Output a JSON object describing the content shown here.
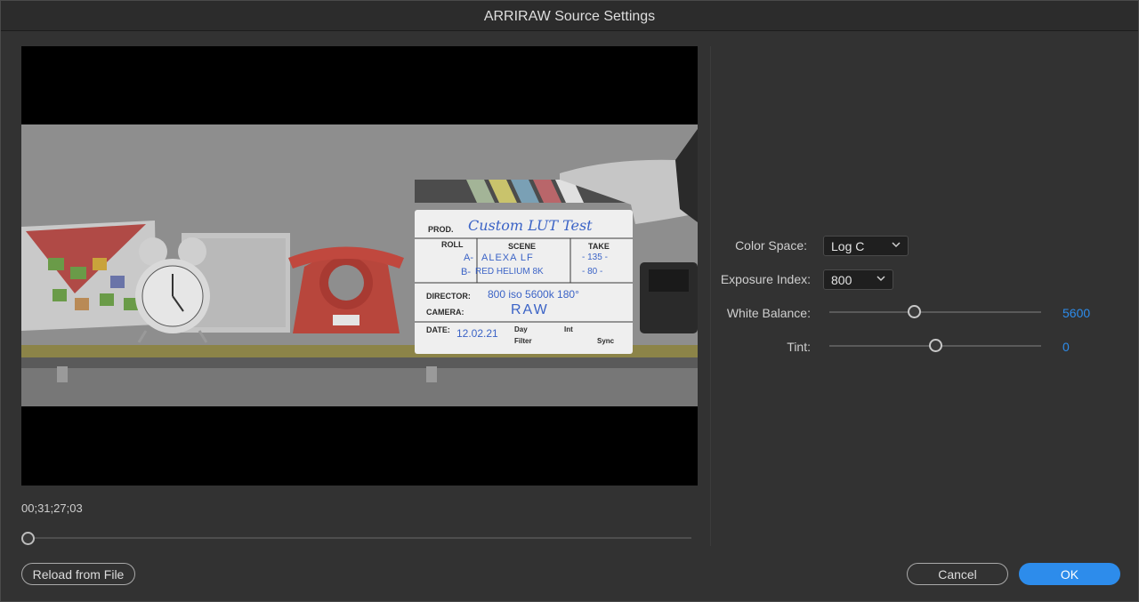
{
  "window": {
    "title": "ARRIRAW Source Settings"
  },
  "preview": {
    "timecode": "00;31;27;03",
    "scrub_position": 0.0,
    "slate": {
      "prod_label": "PROD.",
      "prod_value": "Custom LUT Test",
      "roll_label": "ROLL",
      "scene_label": "SCENE",
      "take_label": "TAKE",
      "roll_a": "A-",
      "roll_b": "B-",
      "scene_a": "ALEXA LF",
      "scene_b": "RED HELIUM 8K",
      "take_a": "- 135 -",
      "take_b": "- 80 -",
      "director_label": "DIRECTOR:",
      "director_value": "800 iso   5600k 180°",
      "camera_label": "CAMERA:",
      "camera_value": "RAW",
      "date_label": "DATE:",
      "date_value": "12.02.21",
      "day_label": "Day",
      "int_label": "Int",
      "filter_label": "Filter",
      "sync_label": "Sync"
    },
    "colors": {
      "slate_ink": "#3b63c6",
      "clock_red": "#c7392d"
    }
  },
  "settings": {
    "color_space": {
      "label": "Color Space:",
      "value": "Log C"
    },
    "exposure_index": {
      "label": "Exposure Index:",
      "value": "800"
    },
    "white_balance": {
      "label": "White Balance:",
      "value": "5600",
      "slider_fraction": 0.4
    },
    "tint": {
      "label": "Tint:",
      "value": "0",
      "slider_fraction": 0.5
    }
  },
  "buttons": {
    "reload": "Reload from File",
    "cancel": "Cancel",
    "ok": "OK"
  },
  "accent_color": "#2d8ceb"
}
